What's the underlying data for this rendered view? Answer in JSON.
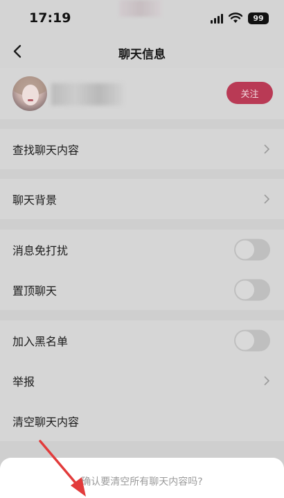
{
  "status_bar": {
    "time": "17:19",
    "battery": "99"
  },
  "nav": {
    "title": "聊天信息"
  },
  "profile": {
    "follow_label": "关注"
  },
  "groups": [
    {
      "rows": [
        {
          "label": "查找聊天内容",
          "type": "chevron"
        }
      ]
    },
    {
      "rows": [
        {
          "label": "聊天背景",
          "type": "chevron"
        }
      ]
    },
    {
      "rows": [
        {
          "label": "消息免打扰",
          "type": "toggle",
          "on": false
        },
        {
          "label": "置顶聊天",
          "type": "toggle",
          "on": false
        }
      ]
    },
    {
      "rows": [
        {
          "label": "加入黑名单",
          "type": "toggle",
          "on": false
        },
        {
          "label": "举报",
          "type": "chevron"
        },
        {
          "label": "清空聊天内容",
          "type": "none"
        }
      ]
    }
  ],
  "confirm_sheet": {
    "message": "确认要清空所有聊天内容吗?"
  },
  "colors": {
    "accent": "#b93a55",
    "annotation_arrow": "#e23b3b"
  }
}
